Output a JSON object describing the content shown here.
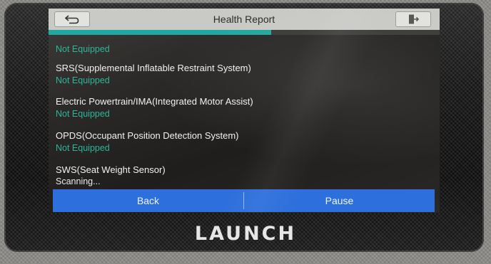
{
  "header": {
    "title": "Health Report",
    "back_icon": "return-arrow-icon",
    "exit_icon": "exit-door-icon"
  },
  "progress": {
    "fraction": 0.57,
    "color": "#21a8a0"
  },
  "systems": [
    {
      "name": "",
      "status": "Not Equipped"
    },
    {
      "name": "SRS(Supplemental Inflatable Restraint System)",
      "status": "Not Equipped"
    },
    {
      "name": "Electric Powertrain/IMA(Integrated Motor Assist)",
      "status": "Not Equipped"
    },
    {
      "name": "OPDS(Occupant Position Detection System)",
      "status": "Not Equipped"
    },
    {
      "name": "SWS(Seat Weight Sensor)",
      "status": "Scanning..."
    }
  ],
  "footer": {
    "back_label": "Back",
    "pause_label": "Pause"
  },
  "device": {
    "brand": "LAUNCH"
  },
  "colors": {
    "status_green": "#2eb59a",
    "button_blue": "#2d6fdc",
    "titlebar": "#c9c9c6"
  }
}
